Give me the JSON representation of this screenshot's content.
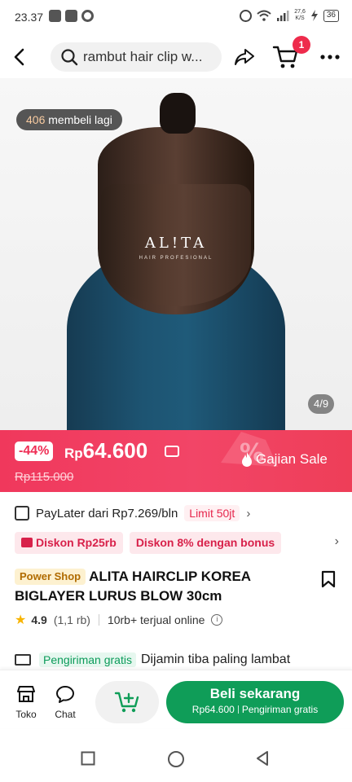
{
  "status_bar": {
    "time": "23.37",
    "speed_top": "27,6",
    "speed_unit": "K/S",
    "battery": "36"
  },
  "header": {
    "search_text": "rambut hair clip w...",
    "cart_count": "1"
  },
  "product_image": {
    "buyers_count": "406",
    "buyers_label": "membeli lagi",
    "brand_logo": "AL!TA",
    "brand_tagline": "HAIR PROFESIONAL",
    "image_counter": "4/9"
  },
  "price": {
    "discount": "-44%",
    "currency": "Rp",
    "amount": "64.600",
    "original": "Rp115.000",
    "campaign": "Gajian Sale"
  },
  "paylater": {
    "text": "PayLater dari Rp7.269/bln",
    "limit": "Limit 50jt"
  },
  "vouchers": [
    {
      "label": "Diskon Rp25rb"
    },
    {
      "label": "Diskon 8% dengan bonus"
    }
  ],
  "product": {
    "shop_badge": "Power Shop",
    "title": "ALITA HAIRCLIP KOREA BIGLAYER LURUS BLOW 30cm",
    "rating": "4.9",
    "review_count": "(1,1 rb)",
    "sold": "10rb+ terjual online"
  },
  "shipping": {
    "free_label": "Pengiriman gratis",
    "text": "Dijamin tiba paling lambat"
  },
  "action_bar": {
    "store_label": "Toko",
    "chat_label": "Chat",
    "buy_label": "Beli sekarang",
    "buy_price": "Rp64.600",
    "buy_shipping": "Pengiriman gratis"
  },
  "colors": {
    "accent_red": "#f0385c",
    "buy_green": "#0f9d58"
  }
}
